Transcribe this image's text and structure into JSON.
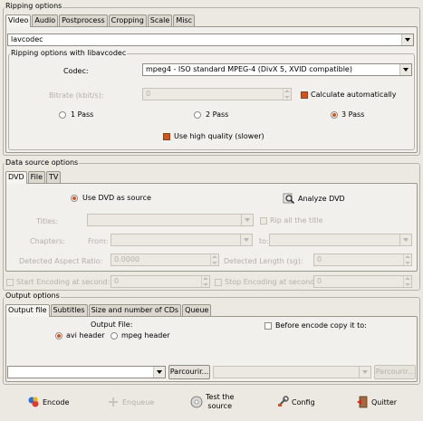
{
  "ripping": {
    "group_title": "Ripping options",
    "tabs": [
      "Video",
      "Audio",
      "Postprocess",
      "Cropping",
      "Scale",
      "Misc"
    ],
    "codec_lib": "lavcodec",
    "sub_title": "Ripping options with libavcodec",
    "codec_label": "Codec:",
    "codec_value": "mpeg4 - ISO standard MPEG-4 (DivX 5, XVID compatible)",
    "bitrate_label": "Bitrate (kbit/s):",
    "bitrate_value": "0",
    "calc_auto": "Calculate automatically",
    "pass1": "1 Pass",
    "pass2": "2 Pass",
    "pass3": "3 Pass",
    "high_quality": "Use high quality (slower)"
  },
  "source": {
    "group_title": "Data source options",
    "tabs": [
      "DVD",
      "File",
      "TV"
    ],
    "use_dvd": "Use DVD as source",
    "analyze": "Analyze DVD",
    "titles_label": "Titles:",
    "rip_all": "Rip all the title",
    "chapters_label": "Chapters:",
    "from_label": "From:",
    "to_label": "to:",
    "aspect_label": "Detected Aspect Ratio:",
    "aspect_value": "0.0000",
    "length_label": "Detected Length (sg):",
    "length_value": "0",
    "start_label": "Start Encoding at second:",
    "start_value": "0",
    "stop_label": "Stop Encoding at second",
    "stop_value": "0"
  },
  "output": {
    "group_title": "Output options",
    "tabs": [
      "Output file",
      "Subtitles",
      "Size and number of CDs",
      "Queue"
    ],
    "file_label": "Output File:",
    "avi": "avi header",
    "mpeg": "mpeg header",
    "copy_before": "Before encode copy it to:",
    "browse1": "Parcourir...",
    "browse2": "Parcourir..."
  },
  "footer": {
    "encode": "Encode",
    "enqueue": "Enqueue",
    "test_line1": "Test the",
    "test_line2": "source",
    "config": "Config",
    "quit": "Quitter"
  },
  "colors": {
    "accent": "#d6541b",
    "bg": "#ece9e3"
  }
}
